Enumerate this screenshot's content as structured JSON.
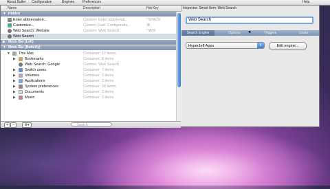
{
  "menubar": {
    "items": [
      "About Butler",
      "Configuration",
      "Engines",
      "Preferences"
    ],
    "right": "Help"
  },
  "columns": {
    "name": "Name",
    "description": "Description",
    "hotkey": "Hot Key"
  },
  "groups": [
    {
      "label": "Hidden",
      "expanded": true
    },
    {
      "label": "Menu Bar (Left)",
      "expanded": false
    },
    {
      "label": "Menu Bar (Butterly)",
      "expanded": true
    }
  ],
  "hidden_rows": [
    {
      "name": "Enter abbreviation...",
      "desc": "Custom: Enter abbreviati...",
      "key": "^SPACE"
    },
    {
      "name": "Customize...",
      "desc": "Custom Cust: Configuratio...",
      "key": "⌘,"
    },
    {
      "name": "Web Search: Website",
      "desc": "Custom: Web Search",
      "key": "^⌘W"
    },
    {
      "name": "Web Search",
      "desc": "Custom: Web Search",
      "key": "^⌘W"
    }
  ],
  "menu_rows": [
    {
      "name": "This Mac",
      "desc": "Container: 12 items",
      "key": ""
    },
    {
      "name": "Bookmarks",
      "desc": "Container: 8 items",
      "key": ""
    },
    {
      "name": "Web Search: Google",
      "desc": "Custom: Web Search",
      "key": "^⌘G"
    },
    {
      "name": "Switch users",
      "desc": "Container: 7 items",
      "key": ""
    },
    {
      "name": "Volumes",
      "desc": "Container: 3 items",
      "key": ""
    },
    {
      "name": "Applications",
      "desc": "Container: 3 items",
      "key": ""
    },
    {
      "name": "System preferences",
      "desc": "Container: 28 items",
      "key": ""
    },
    {
      "name": "Documents",
      "desc": "Container: 3 items",
      "key": ""
    },
    {
      "name": "Music",
      "desc": "Container: 3 items",
      "key": ""
    }
  ],
  "bottombar": {
    "add": "+",
    "remove": "−",
    "action": "⚙▾",
    "search_placeholder": "Search"
  },
  "inspector": {
    "title": "Inspector: Smart Item: Web Search",
    "name_value": "Web Search",
    "tabs": [
      "Search Engine",
      "Options",
      "Triggers",
      "Looks"
    ],
    "active_tab": "Search Engine",
    "engine_value": "HyperJeff Apps",
    "edit_button": "Edit engine..."
  }
}
